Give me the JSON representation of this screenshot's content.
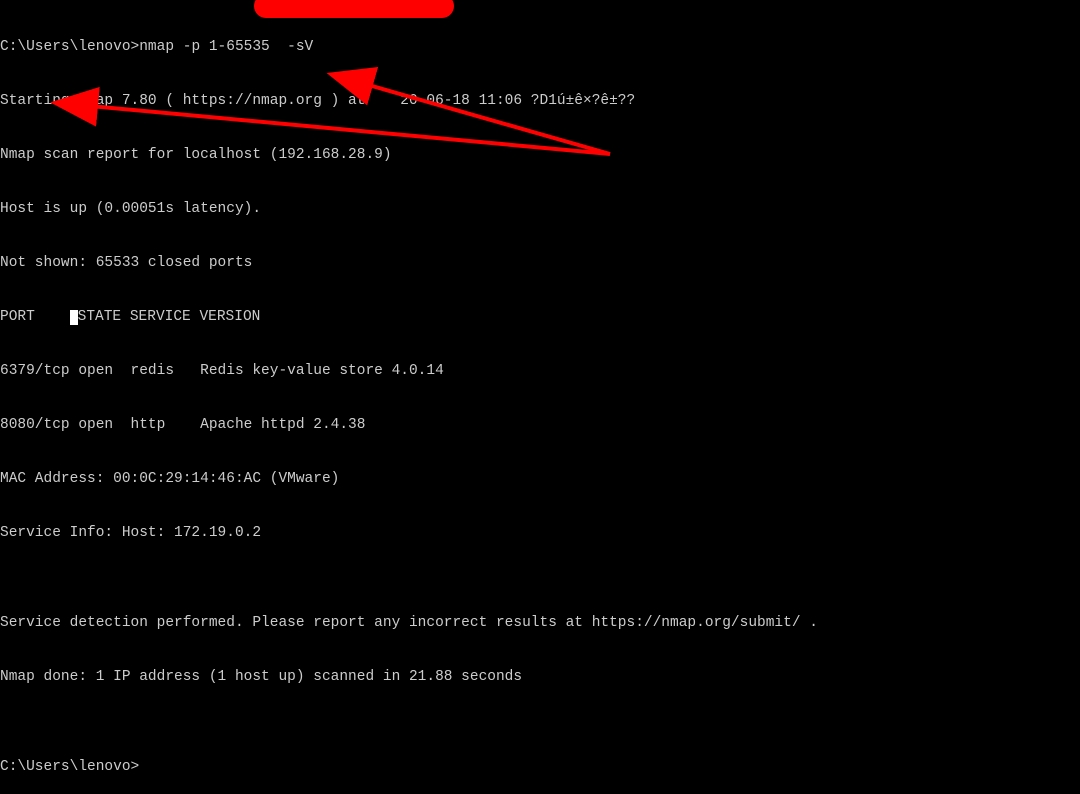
{
  "terminal": {
    "prompt1": "C:\\Users\\lenovo>",
    "command1": "nmap -p 1-65535  -sV",
    "lines": [
      "Starting Nmap 7.80 ( https://nmap.org ) at    20-06-18 11:06 ?D1ú±ê×?ê±??",
      "Nmap scan report for localhost (192.168.28.9)",
      "Host is up (0.00051s latency).",
      "Not shown: 65533 closed ports",
      "PORT     STATE SERVICE VERSION",
      "6379/tcp open  redis   Redis key-value store 4.0.14",
      "8080/tcp open  http    Apache httpd 2.4.38",
      "MAC Address: 00:0C:29:14:46:AC (VMware)",
      "Service Info: Host: 172.19.0.2",
      "",
      "Service detection performed. Please report any incorrect results at https://nmap.org/submit/ .",
      "Nmap done: 1 IP address (1 host up) scanned in 21.88 seconds",
      ""
    ],
    "prompt2": "C:\\Users\\lenovo>"
  }
}
